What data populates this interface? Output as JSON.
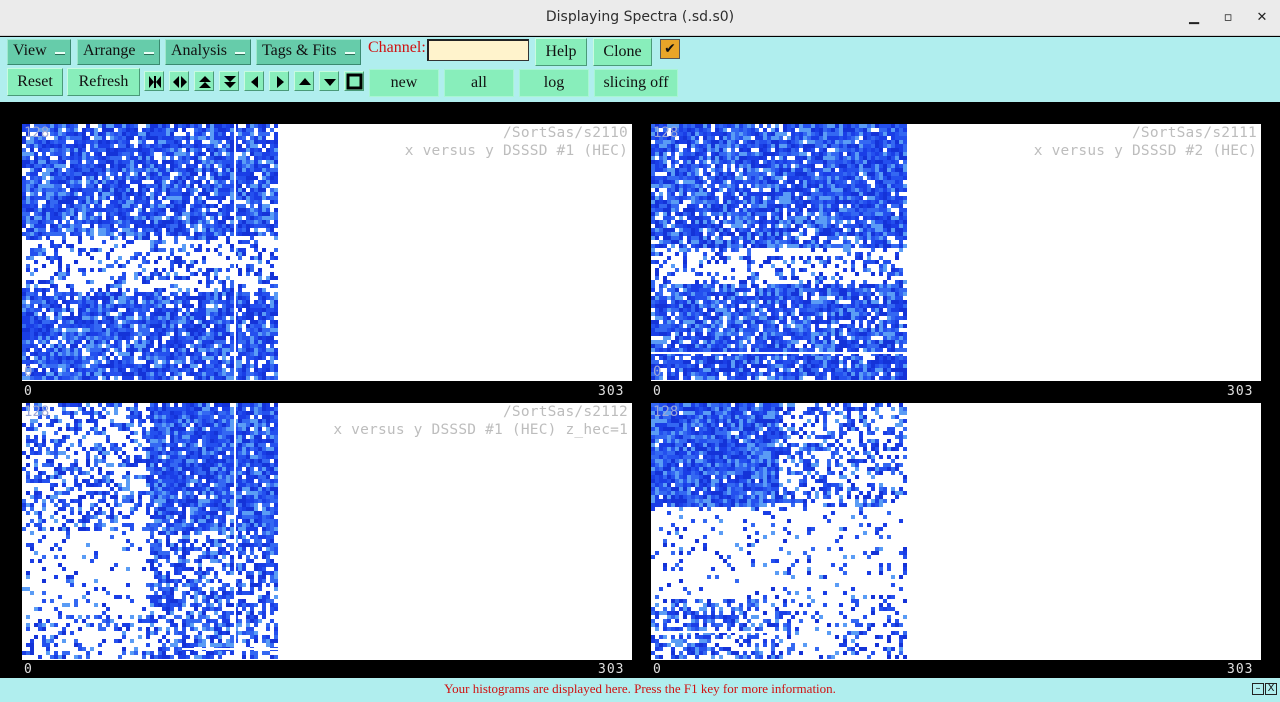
{
  "window": {
    "title": "Displaying Spectra (.sd.s0)",
    "minimize_glyph": "▁",
    "maximize_glyph": "▫",
    "close_glyph": "✕"
  },
  "toolbar": {
    "menus": [
      "View",
      "Arrange",
      "Analysis",
      "Tags & Fits"
    ],
    "channel_label": "Channel:",
    "channel_value": "",
    "help_label": "Help",
    "clone_label": "Clone",
    "checkbox_checked": true,
    "check_glyph": "✔",
    "reset_label": "Reset",
    "refresh_label": "Refresh",
    "nav_icons": [
      "first-page-icon",
      "expand-horizontal-icon",
      "expand-up-icon",
      "expand-down-icon",
      "prev-icon",
      "next-icon",
      "up-icon",
      "down-icon",
      "stop-square-icon"
    ],
    "new_label": "new",
    "all_label": "all",
    "log_label": "log",
    "slicing_label": "slicing off"
  },
  "panels": [
    {
      "path": "/SortSas/s2110",
      "title": "x versus y DSSSD #1 (HEC)",
      "ymax": "128",
      "ymin": "0",
      "xmin": "0",
      "xmax": "303"
    },
    {
      "path": "/SortSas/s2111",
      "title": "x versus y DSSSD #2 (HEC)",
      "ymax": "128",
      "ymin": "0",
      "xmin": "0",
      "xmax": "303"
    },
    {
      "path": "/SortSas/s2112",
      "title": "x versus y DSSSD #1 (HEC) z_hec=1",
      "ymax": "128",
      "ymin": "",
      "xmin": "0",
      "xmax": "303"
    },
    {
      "path": "",
      "title": "",
      "ymax": "128",
      "ymin": "",
      "xmin": "0",
      "xmax": "303"
    }
  ],
  "status": {
    "message": "Your histograms are displayed here. Press the F1 key for more information.",
    "min_glyph": "–",
    "close_glyph": "X"
  },
  "colors": {
    "toolbar_bg": "#b0eeee",
    "menu_bg": "#66ccaa",
    "button_bg": "#88eebb",
    "heat_dark": "#1a3ee6",
    "heat_light": "#5a9cf5",
    "status_text": "#d01010"
  }
}
